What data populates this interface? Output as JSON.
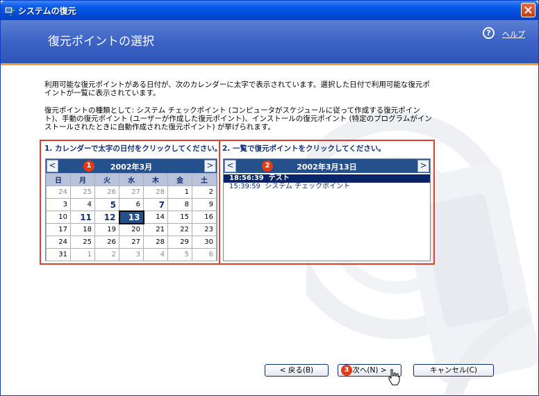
{
  "window": {
    "title": "システムの復元"
  },
  "header": {
    "page_title": "復元ポイントの選択",
    "help_icon": "?",
    "help_label": "ヘルプ"
  },
  "description": {
    "paragraph1": "利用可能な復元ポイントがある日付が、次のカレンダーに太字で表示されています。選択した日付で利用可能な復元ポイントが一覧に表示されています。",
    "paragraph2": "復元ポイントの種類として: システム チェックポイント (コンピュータがスケジュールに従って作成する復元ポイント)、手動の復元ポイント (ユーザーが作成した復元ポイント)、インストールの復元ポイント (特定のプログラムがインストールされたときに自動作成された復元ポイント) が挙げられます。"
  },
  "steps": {
    "step1": "1. カレンダーで太字の日付をクリックしてください。",
    "step2": "2. 一覧で復元ポイントをクリックしてください。"
  },
  "calendar": {
    "title": "2002年3月",
    "prev": "<",
    "next": ">",
    "badge": "1",
    "weekdays": [
      "日",
      "月",
      "火",
      "水",
      "木",
      "金",
      "土"
    ],
    "weeks": [
      [
        "24",
        "25",
        "26",
        "27",
        "28",
        "1",
        "2"
      ],
      [
        "3",
        "4",
        "5",
        "6",
        "7",
        "8",
        "9"
      ],
      [
        "10",
        "11",
        "12",
        "13",
        "14",
        "15",
        "16"
      ],
      [
        "17",
        "18",
        "19",
        "20",
        "21",
        "22",
        "23"
      ],
      [
        "24",
        "25",
        "26",
        "27",
        "28",
        "29",
        "30"
      ],
      [
        "31",
        "1",
        "2",
        "3",
        "4",
        "5",
        "6"
      ]
    ]
  },
  "restore_list": {
    "title": "2002年3月13日",
    "prev": "<",
    "next": ">",
    "badge": "2",
    "items": [
      "18:56:39  テスト",
      "15:39:59  システム チェックポイント"
    ]
  },
  "buttons": {
    "back": "< 戻る(B)",
    "next": "次へ(N) >",
    "next_badge": "3",
    "cancel": "キャンセル(C)"
  },
  "colors": {
    "accent_red": "#e0402a",
    "header_blue": "#24518c",
    "selection": "#0a246a"
  }
}
